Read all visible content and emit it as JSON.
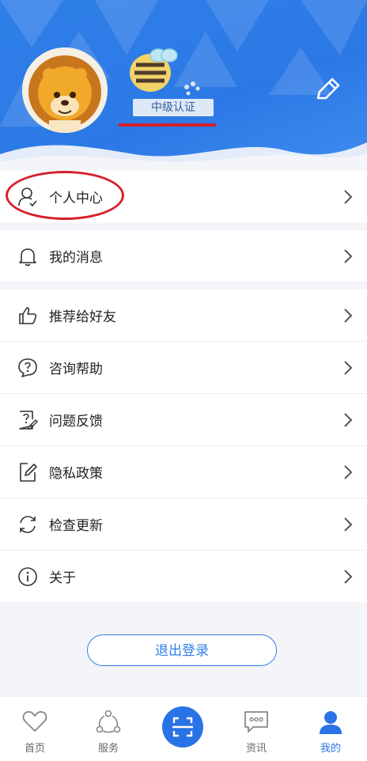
{
  "profile": {
    "level_label": "中级认证"
  },
  "menu": {
    "group1": [
      {
        "label": "个人中心",
        "icon": "user-icon"
      }
    ],
    "group2": [
      {
        "label": "我的消息",
        "icon": "bell-icon"
      }
    ],
    "group3": [
      {
        "label": "推荐给好友",
        "icon": "thumbs-up-icon"
      },
      {
        "label": "咨询帮助",
        "icon": "question-circle-icon"
      },
      {
        "label": "问题反馈",
        "icon": "feedback-icon"
      },
      {
        "label": "隐私政策",
        "icon": "document-edit-icon"
      },
      {
        "label": "检查更新",
        "icon": "refresh-icon"
      },
      {
        "label": "关于",
        "icon": "info-icon"
      }
    ]
  },
  "logout_label": "退出登录",
  "tabs": [
    {
      "label": "首页",
      "icon": "heart-icon"
    },
    {
      "label": "服务",
      "icon": "share-nodes-icon"
    },
    {
      "label": "",
      "icon": "scan-icon"
    },
    {
      "label": "资讯",
      "icon": "chat-bubble-icon"
    },
    {
      "label": "我的",
      "icon": "person-icon"
    }
  ],
  "colors": {
    "primary": "#2a73e6",
    "annotation": "#d6202b",
    "background": "#f4f5f9"
  }
}
